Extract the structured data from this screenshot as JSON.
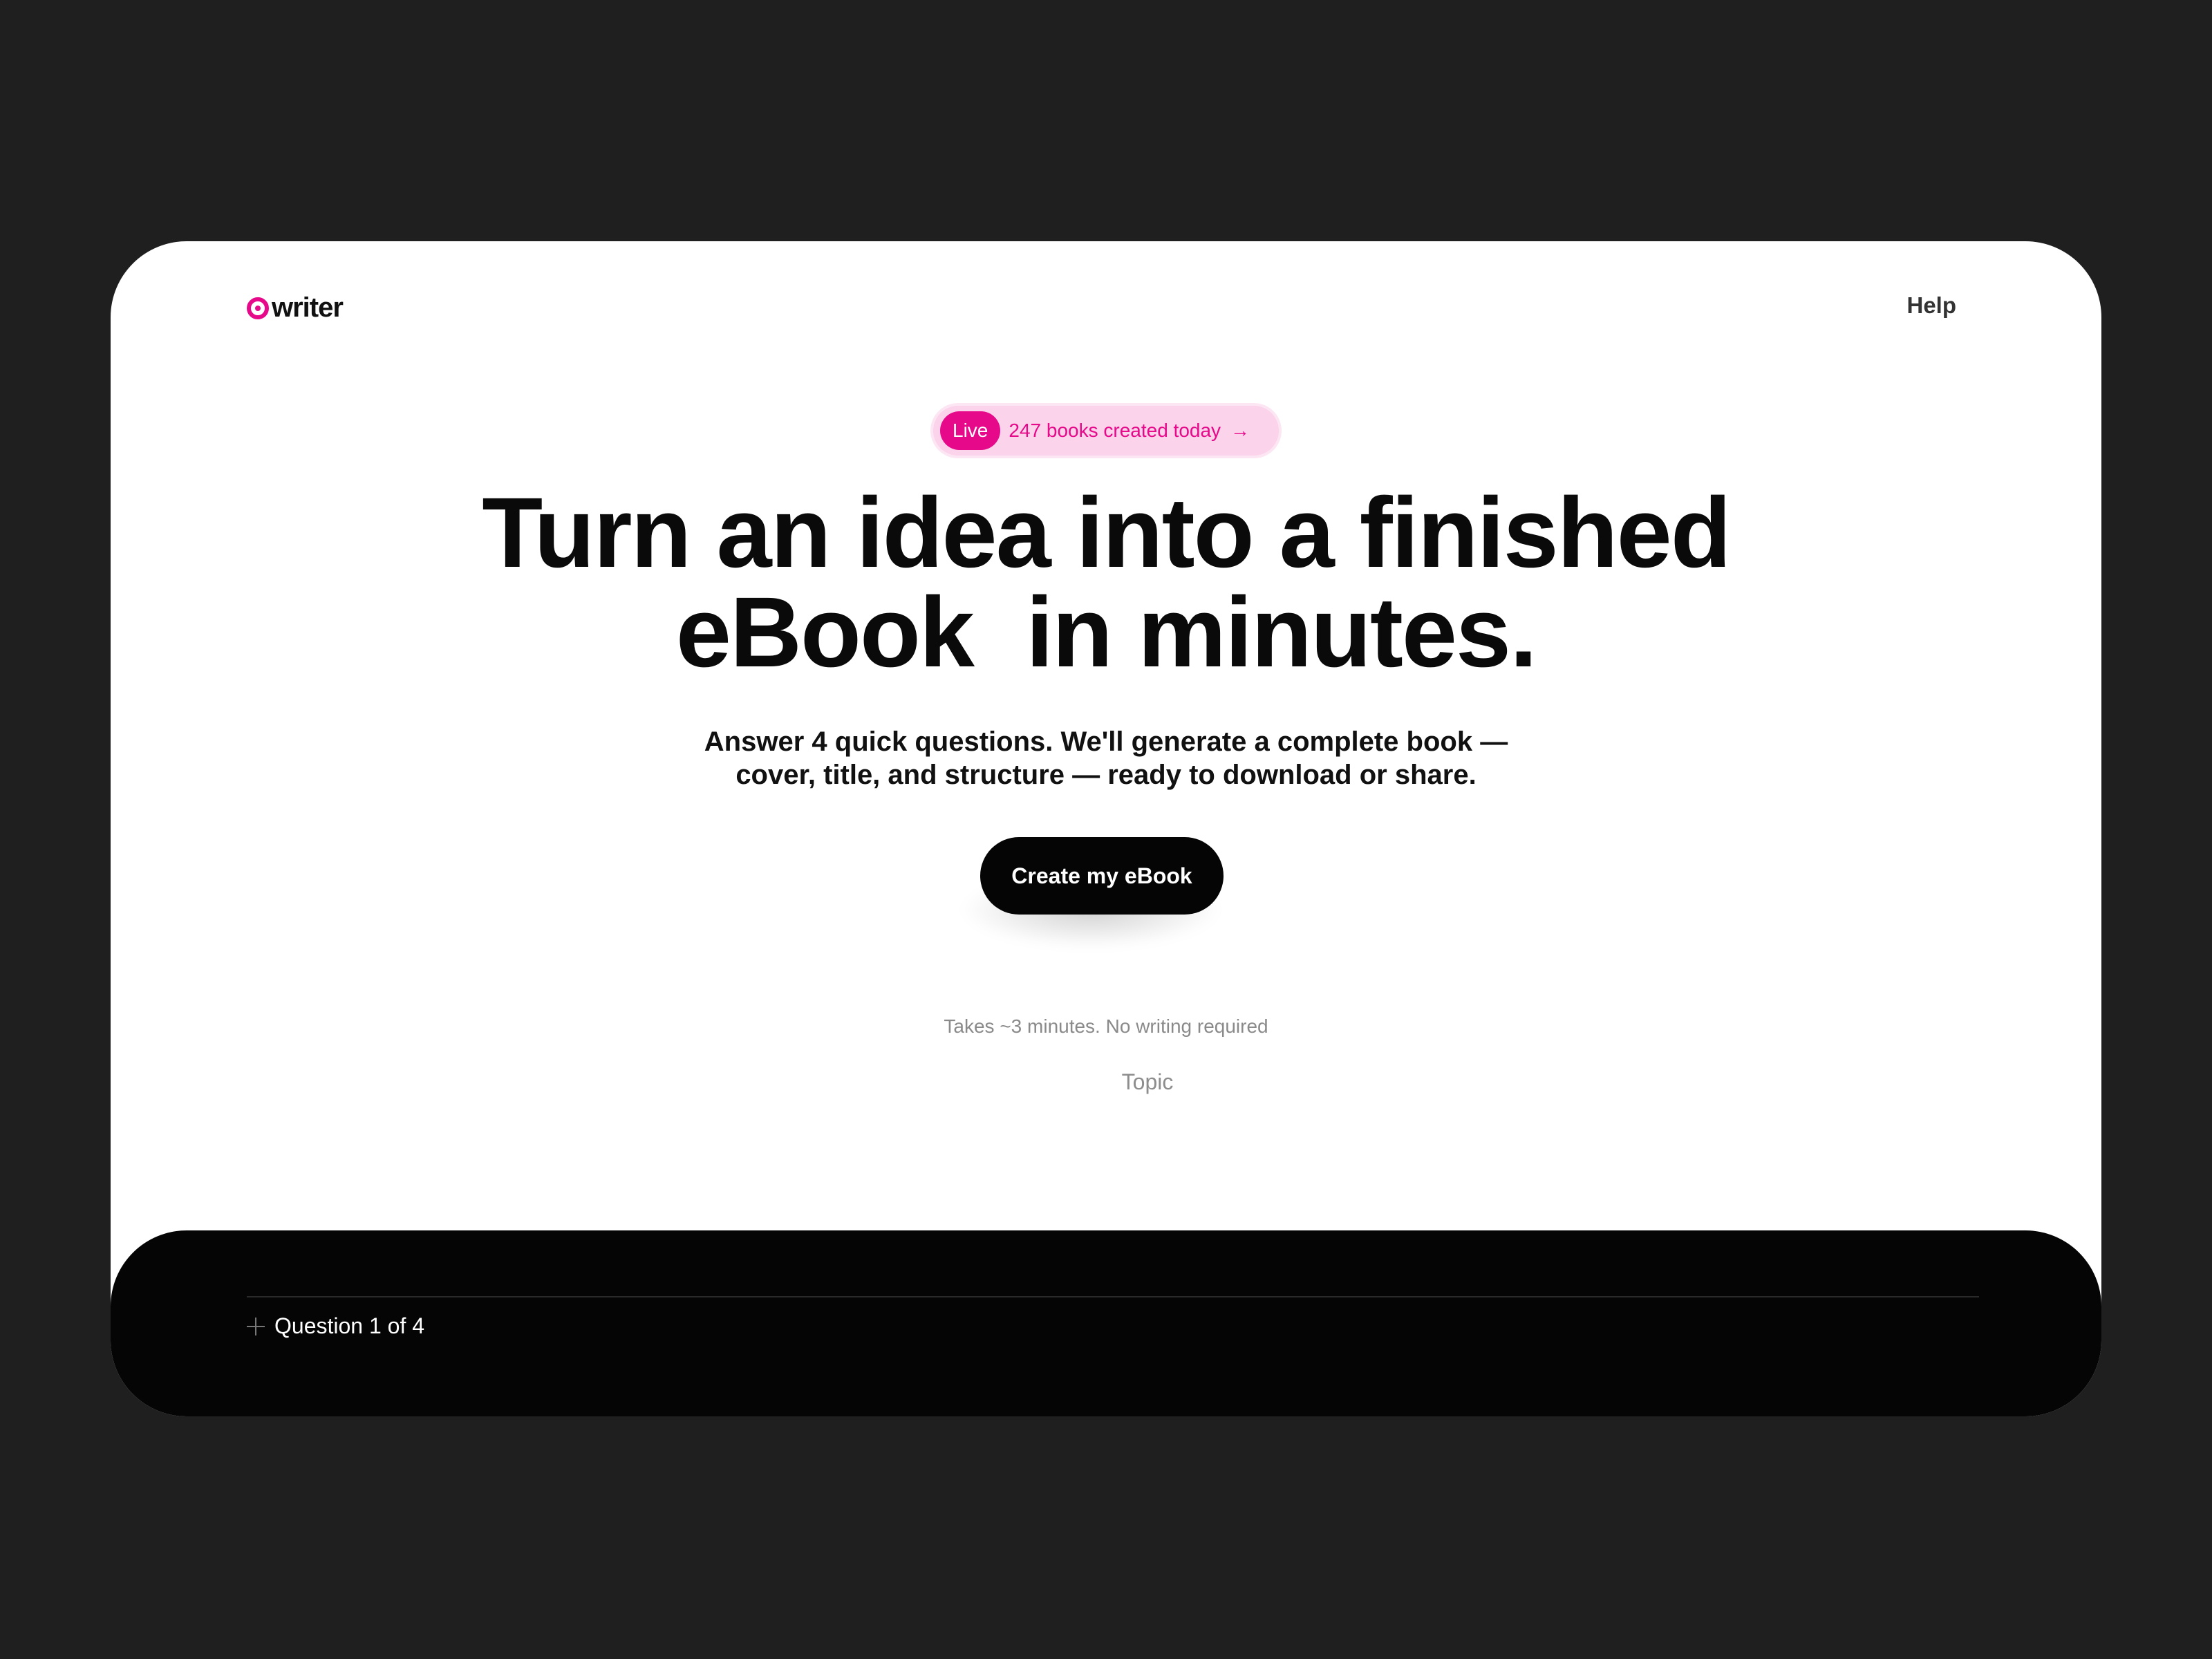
{
  "brand": {
    "name": "writer",
    "icon": "copyright-circle-icon",
    "accent": "#e6098a"
  },
  "nav": {
    "help_label": "Help"
  },
  "live": {
    "badge": "Live",
    "text": "247 books created today",
    "arrow": "→"
  },
  "hero": {
    "headline_line1": "Turn an idea into a finished",
    "headline_line2": "eBook  in minutes.",
    "sub_line1": "Answer 4 quick questions. We'll generate a complete book —",
    "sub_line2": "cover, title, and structure — ready to download or share.",
    "cta_label": "Create my eBook",
    "note": "Takes ~3 minutes. No writing required"
  },
  "quiz": {
    "progress": "Question 1 of 4",
    "step_icon": "plus-icon",
    "topic_placeholder": "Topic",
    "enter_icon": "↴"
  }
}
